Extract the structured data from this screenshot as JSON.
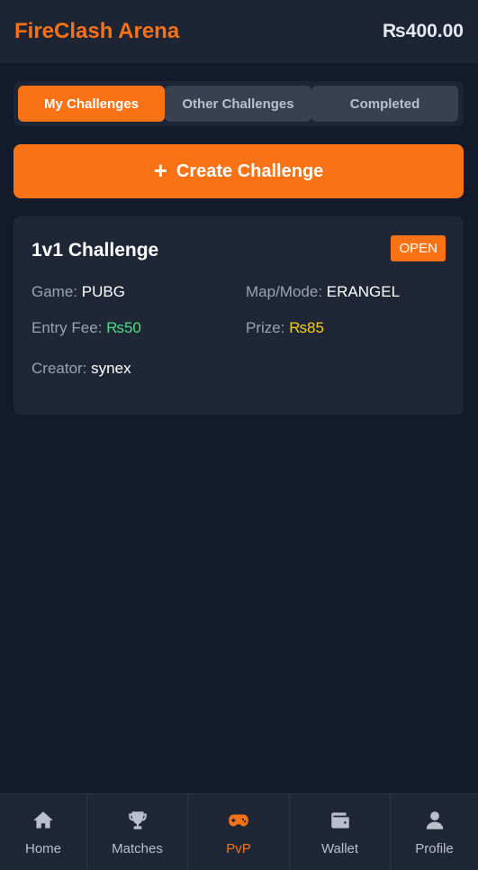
{
  "header": {
    "title": "FireClash Arena",
    "balance": "₨400.00"
  },
  "tabs": [
    {
      "label": "My Challenges",
      "active": true
    },
    {
      "label": "Other Challenges",
      "active": false
    },
    {
      "label": "Completed",
      "active": false
    }
  ],
  "create_button": {
    "icon": "plus-icon",
    "label": "Create Challenge"
  },
  "challenge": {
    "title": "1v1 Challenge",
    "status": "OPEN",
    "game_label": "Game:",
    "game": "PUBG",
    "map_label": "Map/Mode:",
    "map": "ERANGEL",
    "fee_label": "Entry Fee:",
    "fee": "₨50",
    "prize_label": "Prize:",
    "prize": "₨85",
    "creator_label": "Creator:",
    "creator": "synex"
  },
  "nav": [
    {
      "label": "Home",
      "icon": "home-icon"
    },
    {
      "label": "Matches",
      "icon": "trophy-icon"
    },
    {
      "label": "PvP",
      "icon": "gamepad-icon",
      "active": true
    },
    {
      "label": "Wallet",
      "icon": "wallet-icon"
    },
    {
      "label": "Profile",
      "icon": "user-icon"
    }
  ],
  "colors": {
    "accent": "#f97316",
    "background": "#131a2a",
    "card": "#1f2737",
    "green": "#4ade80",
    "yellow": "#facc15"
  }
}
